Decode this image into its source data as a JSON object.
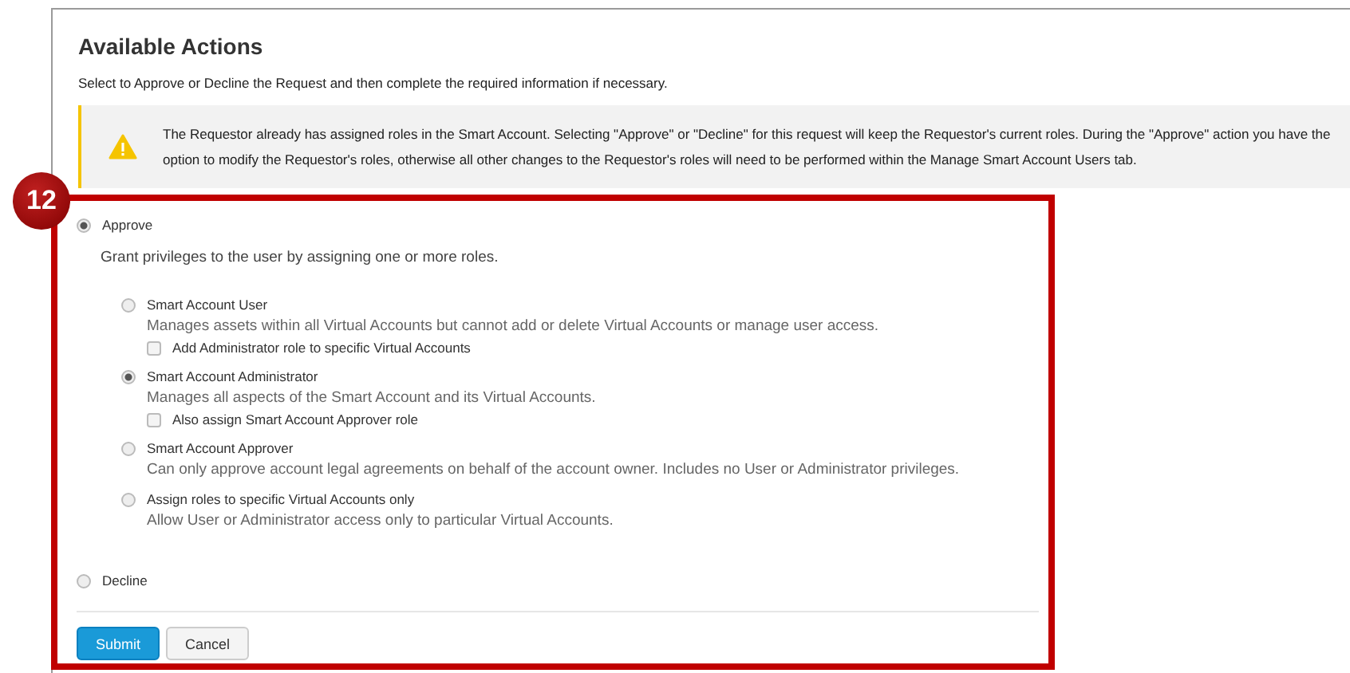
{
  "heading": "Available Actions",
  "instructions": "Select to Approve or Decline the Request and then complete the required information if necessary.",
  "alert": {
    "lines": [
      "The Requestor already has assigned roles in the Smart Account. Selecting \"Approve\" or \"Decline\" for this request will keep the Requestor's current roles. During the \"Approve\" action you have the",
      "option to modify the Requestor's roles, otherwise all other changes to the Requestor's roles will need to be performed within the Manage Smart Account Users tab."
    ]
  },
  "callout_number": "12",
  "actions": [
    {
      "label": "Approve",
      "selected": true,
      "description": "Grant privileges to the user by assigning one or more roles.",
      "roles": [
        {
          "label": "Smart Account User",
          "selected": false,
          "description": "Manages assets within all Virtual Accounts but cannot add or delete Virtual Accounts or manage user access.",
          "option": {
            "label": "Add Administrator role to specific Virtual Accounts",
            "checked": false
          }
        },
        {
          "label": "Smart Account Administrator",
          "selected": true,
          "description": "Manages all aspects of the Smart Account and its Virtual Accounts.",
          "option": {
            "label": "Also assign Smart Account Approver role",
            "checked": false
          }
        },
        {
          "label": "Smart Account Approver",
          "selected": false,
          "description": "Can only approve account legal agreements on behalf of the account owner. Includes no User or Administrator privileges."
        },
        {
          "label": "Assign roles to specific Virtual Accounts only",
          "selected": false,
          "description": "Allow User or Administrator access only to particular Virtual Accounts."
        }
      ]
    },
    {
      "label": "Decline",
      "selected": false
    }
  ],
  "buttons": [
    {
      "label": "Submit",
      "kind": "primary"
    },
    {
      "label": "Cancel",
      "kind": "secondary"
    }
  ]
}
